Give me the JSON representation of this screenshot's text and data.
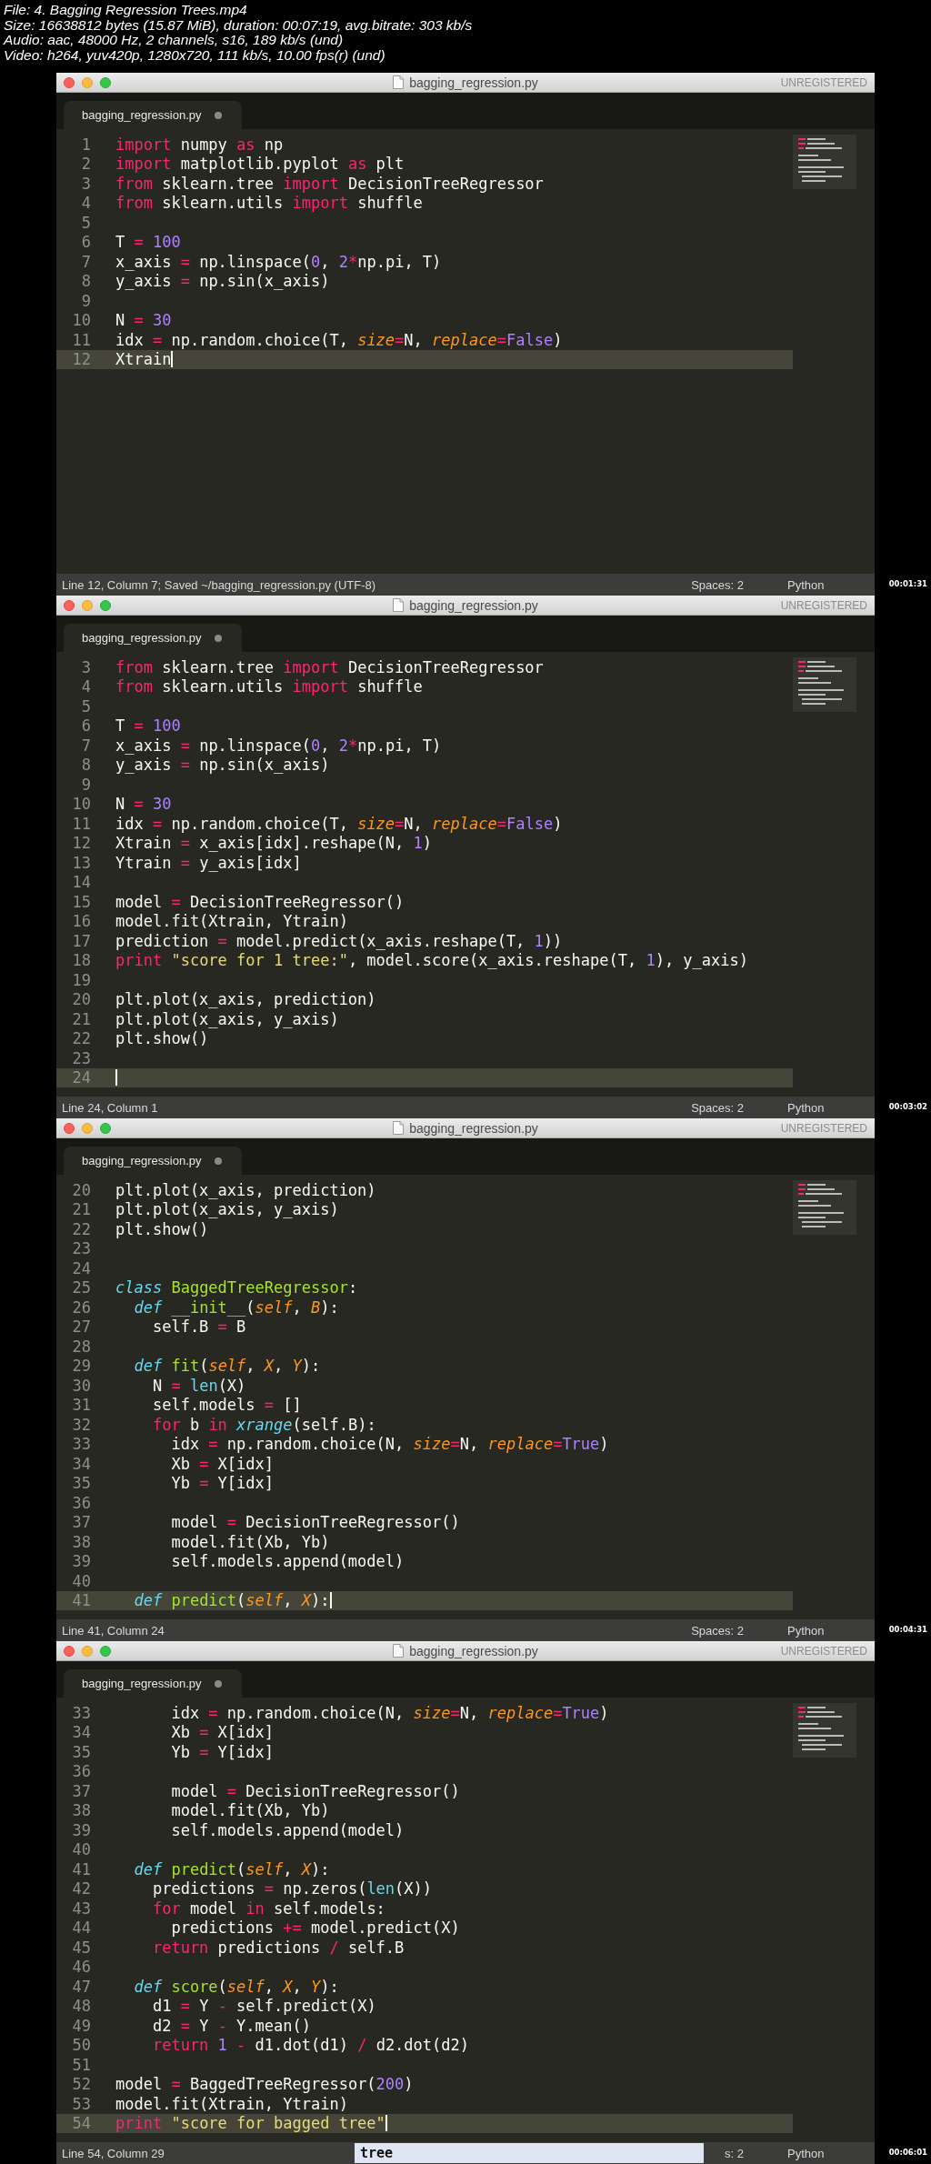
{
  "video_info": [
    "File: 4. Bagging Regression Trees.mp4",
    "Size: 16638812 bytes (15.87 MiB), duration: 00:07:19, avg.bitrate: 303 kb/s",
    "Audio: aac, 48000 Hz, 2 channels, s16, 189 kb/s (und)",
    "Video: h264, yuv420p, 1280x720, 111 kb/s, 10.00 fps(r) (und)"
  ],
  "frames": [
    {
      "window_title": "bagging_regression.py",
      "license": "UNREGISTERED",
      "tab": {
        "label": "bagging_regression.py",
        "modified": true
      },
      "lines": [
        {
          "n": "1",
          "current": false,
          "tokens": [
            {
              "text": "import",
              "kind": "keyword"
            },
            {
              "text": " numpy ",
              "kind": "plain"
            },
            {
              "text": "as",
              "kind": "keyword"
            },
            {
              "text": " np",
              "kind": "plain"
            }
          ]
        },
        {
          "n": "2",
          "current": false,
          "tokens": [
            {
              "text": "import",
              "kind": "keyword"
            },
            {
              "text": " matplotlib.pyplot ",
              "kind": "plain"
            },
            {
              "text": "as",
              "kind": "keyword"
            },
            {
              "text": " plt",
              "kind": "plain"
            }
          ]
        },
        {
          "n": "3",
          "current": false,
          "tokens": [
            {
              "text": "from",
              "kind": "keyword"
            },
            {
              "text": " sklearn.tree ",
              "kind": "plain"
            },
            {
              "text": "import",
              "kind": "keyword"
            },
            {
              "text": " DecisionTreeRegressor",
              "kind": "plain"
            }
          ]
        },
        {
          "n": "4",
          "current": false,
          "tokens": [
            {
              "text": "from",
              "kind": "keyword"
            },
            {
              "text": " sklearn.utils ",
              "kind": "plain"
            },
            {
              "text": "import",
              "kind": "keyword"
            },
            {
              "text": " shuffle",
              "kind": "plain"
            }
          ]
        },
        {
          "n": "5",
          "current": false
        },
        {
          "n": "6",
          "current": false,
          "tokens": [
            {
              "text": "T ",
              "kind": "plain"
            },
            {
              "text": "= ",
              "kind": "keyword"
            },
            {
              "text": "100",
              "kind": "number"
            }
          ]
        },
        {
          "n": "7",
          "current": false,
          "tokens": [
            {
              "text": "x_axis ",
              "kind": "plain"
            },
            {
              "text": "= ",
              "kind": "keyword"
            },
            {
              "text": "np.linspace(",
              "kind": "plain"
            },
            {
              "text": "0",
              "kind": "number"
            },
            {
              "text": ", ",
              "kind": "plain"
            },
            {
              "text": "2",
              "kind": "number"
            },
            {
              "text": "*",
              "kind": "keyword"
            },
            {
              "text": "np.pi, T)",
              "kind": "plain"
            }
          ]
        },
        {
          "n": "8",
          "current": false,
          "tokens": [
            {
              "text": "y_axis ",
              "kind": "plain"
            },
            {
              "text": "= ",
              "kind": "keyword"
            },
            {
              "text": "np.sin(x_axis)",
              "kind": "plain"
            }
          ]
        },
        {
          "n": "9",
          "current": false
        },
        {
          "n": "10",
          "current": false,
          "tokens": [
            {
              "text": "N ",
              "kind": "plain"
            },
            {
              "text": "= ",
              "kind": "keyword"
            },
            {
              "text": "30",
              "kind": "number"
            }
          ]
        },
        {
          "n": "11",
          "current": false,
          "tokens": [
            {
              "text": "idx ",
              "kind": "plain"
            },
            {
              "text": "= ",
              "kind": "keyword"
            },
            {
              "text": "np.random.choice(T, ",
              "kind": "plain"
            },
            {
              "text": "size",
              "kind": "argument"
            },
            {
              "text": "=",
              "kind": "keyword"
            },
            {
              "text": "N, ",
              "kind": "plain"
            },
            {
              "text": "replace",
              "kind": "argument"
            },
            {
              "text": "=",
              "kind": "keyword"
            },
            {
              "text": "False",
              "kind": "number"
            },
            {
              "text": ")",
              "kind": "plain"
            }
          ]
        },
        {
          "n": "12",
          "current": true,
          "tokens": [
            {
              "text": "Xtrain",
              "kind": "plain"
            }
          ]
        }
      ],
      "status": {
        "position": "Line 12, Column 7; Saved ~/bagging_regression.py (UTF-8)",
        "spaces": "Spaces: 2",
        "syntax": "Python"
      },
      "timestamp": "00:01:31"
    },
    {
      "window_title": "bagging_regression.py",
      "license": "UNREGISTERED",
      "tab": {
        "label": "bagging_regression.py",
        "modified": true
      },
      "lines": [
        {
          "n": "3",
          "current": false,
          "tokens": [
            {
              "text": "from",
              "kind": "keyword"
            },
            {
              "text": " sklearn.tree ",
              "kind": "plain"
            },
            {
              "text": "import",
              "kind": "keyword"
            },
            {
              "text": " DecisionTreeRegressor",
              "kind": "plain"
            }
          ]
        },
        {
          "n": "4",
          "current": false,
          "tokens": [
            {
              "text": "from",
              "kind": "keyword"
            },
            {
              "text": " sklearn.utils ",
              "kind": "plain"
            },
            {
              "text": "import",
              "kind": "keyword"
            },
            {
              "text": " shuffle",
              "kind": "plain"
            }
          ]
        },
        {
          "n": "5",
          "current": false
        },
        {
          "n": "6",
          "current": false,
          "tokens": [
            {
              "text": "T ",
              "kind": "plain"
            },
            {
              "text": "= ",
              "kind": "keyword"
            },
            {
              "text": "100",
              "kind": "number"
            }
          ]
        },
        {
          "n": "7",
          "current": false,
          "tokens": [
            {
              "text": "x_axis ",
              "kind": "plain"
            },
            {
              "text": "= ",
              "kind": "keyword"
            },
            {
              "text": "np.linspace(",
              "kind": "plain"
            },
            {
              "text": "0",
              "kind": "number"
            },
            {
              "text": ", ",
              "kind": "plain"
            },
            {
              "text": "2",
              "kind": "number"
            },
            {
              "text": "*",
              "kind": "keyword"
            },
            {
              "text": "np.pi, T)",
              "kind": "plain"
            }
          ]
        },
        {
          "n": "8",
          "current": false,
          "tokens": [
            {
              "text": "y_axis ",
              "kind": "plain"
            },
            {
              "text": "= ",
              "kind": "keyword"
            },
            {
              "text": "np.sin(x_axis)",
              "kind": "plain"
            }
          ]
        },
        {
          "n": "9",
          "current": false
        },
        {
          "n": "10",
          "current": false,
          "tokens": [
            {
              "text": "N ",
              "kind": "plain"
            },
            {
              "text": "= ",
              "kind": "keyword"
            },
            {
              "text": "30",
              "kind": "number"
            }
          ]
        },
        {
          "n": "11",
          "current": false,
          "tokens": [
            {
              "text": "idx ",
              "kind": "plain"
            },
            {
              "text": "= ",
              "kind": "keyword"
            },
            {
              "text": "np.random.choice(T, ",
              "kind": "plain"
            },
            {
              "text": "size",
              "kind": "argument"
            },
            {
              "text": "=",
              "kind": "keyword"
            },
            {
              "text": "N, ",
              "kind": "plain"
            },
            {
              "text": "replace",
              "kind": "argument"
            },
            {
              "text": "=",
              "kind": "keyword"
            },
            {
              "text": "False",
              "kind": "number"
            },
            {
              "text": ")",
              "kind": "plain"
            }
          ]
        },
        {
          "n": "12",
          "current": false,
          "tokens": [
            {
              "text": "Xtrain ",
              "kind": "plain"
            },
            {
              "text": "= ",
              "kind": "keyword"
            },
            {
              "text": "x_axis[idx].reshape(N, ",
              "kind": "plain"
            },
            {
              "text": "1",
              "kind": "number"
            },
            {
              "text": ")",
              "kind": "plain"
            }
          ]
        },
        {
          "n": "13",
          "current": false,
          "tokens": [
            {
              "text": "Ytrain ",
              "kind": "plain"
            },
            {
              "text": "= ",
              "kind": "keyword"
            },
            {
              "text": "y_axis[idx]",
              "kind": "plain"
            }
          ]
        },
        {
          "n": "14",
          "current": false
        },
        {
          "n": "15",
          "current": false,
          "tokens": [
            {
              "text": "model ",
              "kind": "plain"
            },
            {
              "text": "= ",
              "kind": "keyword"
            },
            {
              "text": "DecisionTreeRegressor()",
              "kind": "plain"
            }
          ]
        },
        {
          "n": "16",
          "current": false,
          "tokens": [
            {
              "text": "model.fit(Xtrain, Ytrain)",
              "kind": "plain"
            }
          ]
        },
        {
          "n": "17",
          "current": false,
          "tokens": [
            {
              "text": "prediction ",
              "kind": "plain"
            },
            {
              "text": "= ",
              "kind": "keyword"
            },
            {
              "text": "model.predict(x_axis.reshape(T, ",
              "kind": "plain"
            },
            {
              "text": "1",
              "kind": "number"
            },
            {
              "text": "))",
              "kind": "plain"
            }
          ]
        },
        {
          "n": "18",
          "current": false,
          "tokens": [
            {
              "text": "print ",
              "kind": "keyword"
            },
            {
              "text": "\"score for 1 tree:\"",
              "kind": "string"
            },
            {
              "text": ", model.score(x_axis.reshape(T, ",
              "kind": "plain"
            },
            {
              "text": "1",
              "kind": "number"
            },
            {
              "text": "), y_axis)",
              "kind": "plain"
            }
          ]
        },
        {
          "n": "19",
          "current": false
        },
        {
          "n": "20",
          "current": false,
          "tokens": [
            {
              "text": "plt.plot(x_axis, prediction)",
              "kind": "plain"
            }
          ]
        },
        {
          "n": "21",
          "current": false,
          "tokens": [
            {
              "text": "plt.plot(x_axis, y_axis)",
              "kind": "plain"
            }
          ]
        },
        {
          "n": "22",
          "current": false,
          "tokens": [
            {
              "text": "plt.show()",
              "kind": "plain"
            }
          ]
        },
        {
          "n": "23",
          "current": false
        },
        {
          "n": "24",
          "current": true
        }
      ],
      "status": {
        "position": "Line 24, Column 1",
        "spaces": "Spaces: 2",
        "syntax": "Python"
      },
      "timestamp": "00:03:02"
    },
    {
      "window_title": "bagging_regression.py",
      "license": "UNREGISTERED",
      "tab": {
        "label": "bagging_regression.py",
        "modified": true
      },
      "lines": [
        {
          "n": "20",
          "current": false,
          "tokens": [
            {
              "text": "plt.plot(x_axis, prediction)",
              "kind": "plain"
            }
          ]
        },
        {
          "n": "21",
          "current": false,
          "tokens": [
            {
              "text": "plt.plot(x_axis, y_axis)",
              "kind": "plain"
            }
          ]
        },
        {
          "n": "22",
          "current": false,
          "tokens": [
            {
              "text": "plt.show()",
              "kind": "plain"
            }
          ]
        },
        {
          "n": "23",
          "current": false
        },
        {
          "n": "24",
          "current": false
        },
        {
          "n": "25",
          "current": false,
          "tokens": [
            {
              "text": "class ",
              "kind": "storage"
            },
            {
              "text": "BaggedTreeRegressor",
              "kind": "name"
            },
            {
              "text": ":",
              "kind": "plain"
            }
          ]
        },
        {
          "n": "26",
          "current": false,
          "tokens": [
            {
              "text": "  def ",
              "kind": "storage"
            },
            {
              "text": "__init__",
              "kind": "name"
            },
            {
              "text": "(",
              "kind": "plain"
            },
            {
              "text": "self",
              "kind": "argument"
            },
            {
              "text": ", ",
              "kind": "plain"
            },
            {
              "text": "B",
              "kind": "argument"
            },
            {
              "text": "):",
              "kind": "plain"
            }
          ]
        },
        {
          "n": "27",
          "current": false,
          "tokens": [
            {
              "text": "    self.B ",
              "kind": "plain"
            },
            {
              "text": "= ",
              "kind": "keyword"
            },
            {
              "text": "B",
              "kind": "plain"
            }
          ]
        },
        {
          "n": "28",
          "current": false
        },
        {
          "n": "29",
          "current": false,
          "tokens": [
            {
              "text": "  def ",
              "kind": "storage"
            },
            {
              "text": "fit",
              "kind": "name"
            },
            {
              "text": "(",
              "kind": "plain"
            },
            {
              "text": "self",
              "kind": "argument"
            },
            {
              "text": ", ",
              "kind": "plain"
            },
            {
              "text": "X",
              "kind": "argument"
            },
            {
              "text": ", ",
              "kind": "plain"
            },
            {
              "text": "Y",
              "kind": "argument"
            },
            {
              "text": "):",
              "kind": "plain"
            }
          ]
        },
        {
          "n": "30",
          "current": false,
          "tokens": [
            {
              "text": "    N ",
              "kind": "plain"
            },
            {
              "text": "= ",
              "kind": "keyword"
            },
            {
              "text": "len",
              "kind": "builtin"
            },
            {
              "text": "(X)",
              "kind": "plain"
            }
          ]
        },
        {
          "n": "31",
          "current": false,
          "tokens": [
            {
              "text": "    self.models ",
              "kind": "plain"
            },
            {
              "text": "= ",
              "kind": "keyword"
            },
            {
              "text": "[]",
              "kind": "plain"
            }
          ]
        },
        {
          "n": "32",
          "current": false,
          "tokens": [
            {
              "text": "    for ",
              "kind": "keyword"
            },
            {
              "text": "b ",
              "kind": "plain"
            },
            {
              "text": "in ",
              "kind": "keyword"
            },
            {
              "text": "xrange",
              "kind": "storage"
            },
            {
              "text": "(self.B):",
              "kind": "plain"
            }
          ]
        },
        {
          "n": "33",
          "current": false,
          "tokens": [
            {
              "text": "      idx ",
              "kind": "plain"
            },
            {
              "text": "= ",
              "kind": "keyword"
            },
            {
              "text": "np.random.choice(N, ",
              "kind": "plain"
            },
            {
              "text": "size",
              "kind": "argument"
            },
            {
              "text": "=",
              "kind": "keyword"
            },
            {
              "text": "N, ",
              "kind": "plain"
            },
            {
              "text": "replace",
              "kind": "argument"
            },
            {
              "text": "=",
              "kind": "keyword"
            },
            {
              "text": "True",
              "kind": "number"
            },
            {
              "text": ")",
              "kind": "plain"
            }
          ]
        },
        {
          "n": "34",
          "current": false,
          "tokens": [
            {
              "text": "      Xb ",
              "kind": "plain"
            },
            {
              "text": "= ",
              "kind": "keyword"
            },
            {
              "text": "X[idx]",
              "kind": "plain"
            }
          ]
        },
        {
          "n": "35",
          "current": false,
          "tokens": [
            {
              "text": "      Yb ",
              "kind": "plain"
            },
            {
              "text": "= ",
              "kind": "keyword"
            },
            {
              "text": "Y[idx]",
              "kind": "plain"
            }
          ]
        },
        {
          "n": "36",
          "current": false
        },
        {
          "n": "37",
          "current": false,
          "tokens": [
            {
              "text": "      model ",
              "kind": "plain"
            },
            {
              "text": "= ",
              "kind": "keyword"
            },
            {
              "text": "DecisionTreeRegressor()",
              "kind": "plain"
            }
          ]
        },
        {
          "n": "38",
          "current": false,
          "tokens": [
            {
              "text": "      model.fit(Xb, Yb)",
              "kind": "plain"
            }
          ]
        },
        {
          "n": "39",
          "current": false,
          "tokens": [
            {
              "text": "      self.models.append(model)",
              "kind": "plain"
            }
          ]
        },
        {
          "n": "40",
          "current": false
        },
        {
          "n": "41",
          "current": true,
          "tokens": [
            {
              "text": "  def ",
              "kind": "storage"
            },
            {
              "text": "predict",
              "kind": "name"
            },
            {
              "text": "(",
              "kind": "plain"
            },
            {
              "text": "self",
              "kind": "argument"
            },
            {
              "text": ", ",
              "kind": "plain"
            },
            {
              "text": "X",
              "kind": "argument"
            },
            {
              "text": "):",
              "kind": "plain"
            }
          ]
        }
      ],
      "status": {
        "position": "Line 41, Column 24",
        "spaces": "Spaces: 2",
        "syntax": "Python"
      },
      "timestamp": "00:04:31"
    },
    {
      "window_title": "bagging_regression.py",
      "license": "UNREGISTERED",
      "tab": {
        "label": "bagging_regression.py",
        "modified": true
      },
      "lines": [
        {
          "n": "33",
          "current": false,
          "tokens": [
            {
              "text": "      idx ",
              "kind": "plain"
            },
            {
              "text": "= ",
              "kind": "keyword"
            },
            {
              "text": "np.random.choice(N, ",
              "kind": "plain"
            },
            {
              "text": "size",
              "kind": "argument"
            },
            {
              "text": "=",
              "kind": "keyword"
            },
            {
              "text": "N, ",
              "kind": "plain"
            },
            {
              "text": "replace",
              "kind": "argument"
            },
            {
              "text": "=",
              "kind": "keyword"
            },
            {
              "text": "True",
              "kind": "number"
            },
            {
              "text": ")",
              "kind": "plain"
            }
          ]
        },
        {
          "n": "34",
          "current": false,
          "tokens": [
            {
              "text": "      Xb ",
              "kind": "plain"
            },
            {
              "text": "= ",
              "kind": "keyword"
            },
            {
              "text": "X[idx]",
              "kind": "plain"
            }
          ]
        },
        {
          "n": "35",
          "current": false,
          "tokens": [
            {
              "text": "      Yb ",
              "kind": "plain"
            },
            {
              "text": "= ",
              "kind": "keyword"
            },
            {
              "text": "Y[idx]",
              "kind": "plain"
            }
          ]
        },
        {
          "n": "36",
          "current": false
        },
        {
          "n": "37",
          "current": false,
          "tokens": [
            {
              "text": "      model ",
              "kind": "plain"
            },
            {
              "text": "= ",
              "kind": "keyword"
            },
            {
              "text": "DecisionTreeRegressor()",
              "kind": "plain"
            }
          ]
        },
        {
          "n": "38",
          "current": false,
          "tokens": [
            {
              "text": "      model.fit(Xb, Yb)",
              "kind": "plain"
            }
          ]
        },
        {
          "n": "39",
          "current": false,
          "tokens": [
            {
              "text": "      self.models.append(model)",
              "kind": "plain"
            }
          ]
        },
        {
          "n": "40",
          "current": false
        },
        {
          "n": "41",
          "current": false,
          "tokens": [
            {
              "text": "  def ",
              "kind": "storage"
            },
            {
              "text": "predict",
              "kind": "name"
            },
            {
              "text": "(",
              "kind": "plain"
            },
            {
              "text": "self",
              "kind": "argument"
            },
            {
              "text": ", ",
              "kind": "plain"
            },
            {
              "text": "X",
              "kind": "argument"
            },
            {
              "text": "):",
              "kind": "plain"
            }
          ]
        },
        {
          "n": "42",
          "current": false,
          "tokens": [
            {
              "text": "    predictions ",
              "kind": "plain"
            },
            {
              "text": "= ",
              "kind": "keyword"
            },
            {
              "text": "np.zeros(",
              "kind": "plain"
            },
            {
              "text": "len",
              "kind": "builtin"
            },
            {
              "text": "(X))",
              "kind": "plain"
            }
          ]
        },
        {
          "n": "43",
          "current": false,
          "tokens": [
            {
              "text": "    for ",
              "kind": "keyword"
            },
            {
              "text": "model ",
              "kind": "plain"
            },
            {
              "text": "in ",
              "kind": "keyword"
            },
            {
              "text": "self.models:",
              "kind": "plain"
            }
          ]
        },
        {
          "n": "44",
          "current": false,
          "tokens": [
            {
              "text": "      predictions ",
              "kind": "plain"
            },
            {
              "text": "+= ",
              "kind": "keyword"
            },
            {
              "text": "model.predict(X)",
              "kind": "plain"
            }
          ]
        },
        {
          "n": "45",
          "current": false,
          "tokens": [
            {
              "text": "    return ",
              "kind": "keyword"
            },
            {
              "text": "predictions ",
              "kind": "plain"
            },
            {
              "text": "/ ",
              "kind": "keyword"
            },
            {
              "text": "self.B",
              "kind": "plain"
            }
          ]
        },
        {
          "n": "46",
          "current": false
        },
        {
          "n": "47",
          "current": false,
          "tokens": [
            {
              "text": "  def ",
              "kind": "storage"
            },
            {
              "text": "score",
              "kind": "name"
            },
            {
              "text": "(",
              "kind": "plain"
            },
            {
              "text": "self",
              "kind": "argument"
            },
            {
              "text": ", ",
              "kind": "plain"
            },
            {
              "text": "X",
              "kind": "argument"
            },
            {
              "text": ", ",
              "kind": "plain"
            },
            {
              "text": "Y",
              "kind": "argument"
            },
            {
              "text": "):",
              "kind": "plain"
            }
          ]
        },
        {
          "n": "48",
          "current": false,
          "tokens": [
            {
              "text": "    d1 ",
              "kind": "plain"
            },
            {
              "text": "= ",
              "kind": "keyword"
            },
            {
              "text": "Y ",
              "kind": "plain"
            },
            {
              "text": "- ",
              "kind": "keyword"
            },
            {
              "text": "self.predict(X)",
              "kind": "plain"
            }
          ]
        },
        {
          "n": "49",
          "current": false,
          "tokens": [
            {
              "text": "    d2 ",
              "kind": "plain"
            },
            {
              "text": "= ",
              "kind": "keyword"
            },
            {
              "text": "Y ",
              "kind": "plain"
            },
            {
              "text": "- ",
              "kind": "keyword"
            },
            {
              "text": "Y.mean()",
              "kind": "plain"
            }
          ]
        },
        {
          "n": "50",
          "current": false,
          "tokens": [
            {
              "text": "    return ",
              "kind": "keyword"
            },
            {
              "text": "1 ",
              "kind": "number"
            },
            {
              "text": "- ",
              "kind": "keyword"
            },
            {
              "text": "d1.dot(d1) ",
              "kind": "plain"
            },
            {
              "text": "/ ",
              "kind": "keyword"
            },
            {
              "text": "d2.dot(d2)",
              "kind": "plain"
            }
          ]
        },
        {
          "n": "51",
          "current": false
        },
        {
          "n": "52",
          "current": false,
          "tokens": [
            {
              "text": "model ",
              "kind": "plain"
            },
            {
              "text": "= ",
              "kind": "keyword"
            },
            {
              "text": "BaggedTreeRegressor(",
              "kind": "plain"
            },
            {
              "text": "200",
              "kind": "number"
            },
            {
              "text": ")",
              "kind": "plain"
            }
          ]
        },
        {
          "n": "53",
          "current": false,
          "tokens": [
            {
              "text": "model.fit(Xtrain, Ytrain)",
              "kind": "plain"
            }
          ]
        },
        {
          "n": "54",
          "current": true,
          "tokens": [
            {
              "text": "print ",
              "kind": "keyword"
            },
            {
              "text": "\"score for bagged tree\"",
              "kind": "string"
            }
          ]
        }
      ],
      "status": {
        "position": "Line 54, Column 29",
        "spaces": "s: 2",
        "syntax": "Python"
      },
      "autocomplete": [
        "tree"
      ],
      "timestamp": "00:06:01"
    }
  ]
}
